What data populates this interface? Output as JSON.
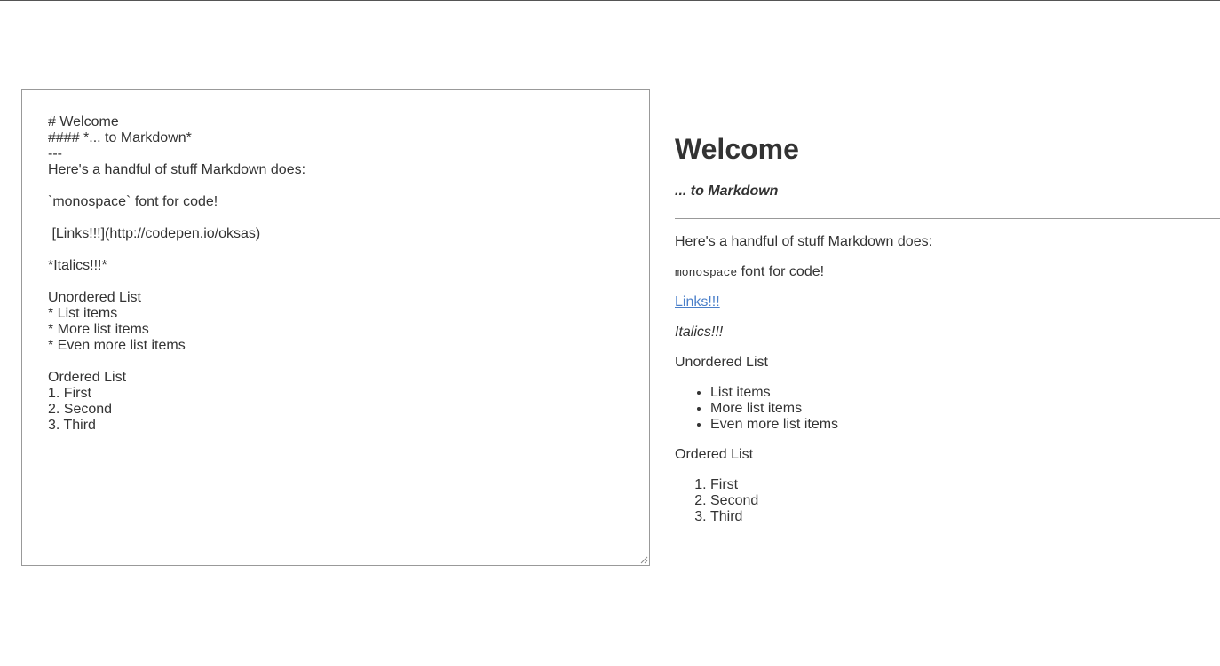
{
  "editor": {
    "content": "# Welcome\n#### *... to Markdown*\n---\nHere's a handful of stuff Markdown does:\n\n`monospace` font for code!\n\n [Links!!!](http://codepen.io/oksas)\n\n*Italics!!!*\n\nUnordered List\n* List items\n* More list items\n* Even more list items\n\nOrdered List\n1. First\n2. Second\n3. Third"
  },
  "preview": {
    "h1": "Welcome",
    "h4": "... to Markdown",
    "intro": "Here's a handful of stuff Markdown does:",
    "code_word": "monospace",
    "code_rest": " font for code!",
    "link_text": "Links!!!",
    "italic_text": "Italics!!!",
    "ul_heading": "Unordered List",
    "ul_items": [
      "List items",
      "More list items",
      "Even more list items"
    ],
    "ol_heading": "Ordered List",
    "ol_items": [
      "First",
      "Second",
      "Third"
    ]
  },
  "colors": {
    "text": "#333333",
    "link": "#4a7fc9",
    "border": "#999999"
  }
}
